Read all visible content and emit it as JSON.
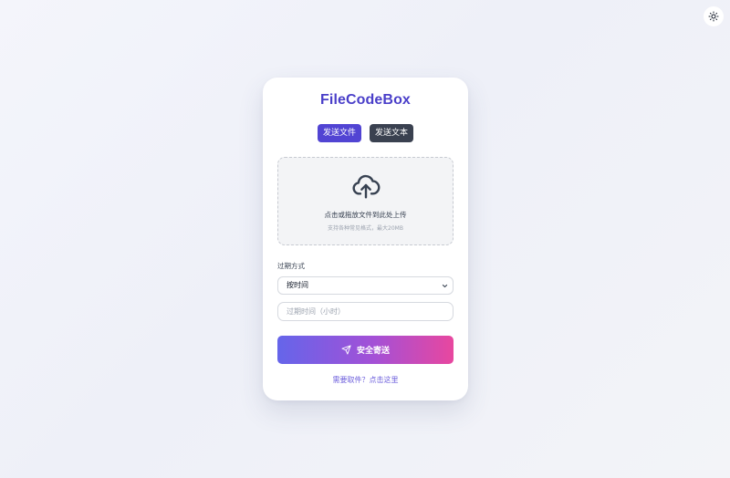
{
  "app": {
    "title": "FileCodeBox"
  },
  "theme_toggle": {
    "icon": "sun-icon"
  },
  "tabs": [
    {
      "label": "发送文件",
      "active": true
    },
    {
      "label": "发送文本",
      "active": false
    }
  ],
  "upload": {
    "icon": "cloud-upload-icon",
    "title": "点击或拖放文件到此处上传",
    "hint": "支持各种常见格式，最大20MB"
  },
  "expire": {
    "label": "过期方式",
    "selected": "按时间",
    "input_placeholder": "过期时间（小时）",
    "input_value": ""
  },
  "send_button": {
    "label": "安全寄送",
    "icon": "send-icon"
  },
  "retrieve_link": {
    "label": "需要取件？点击这里"
  },
  "colors": {
    "brand": "#4a3fc9",
    "tab_active": "#5144d3",
    "tab_inactive": "#3a4150",
    "gradient_start": "#6565ea",
    "gradient_end": "#e8479f"
  }
}
